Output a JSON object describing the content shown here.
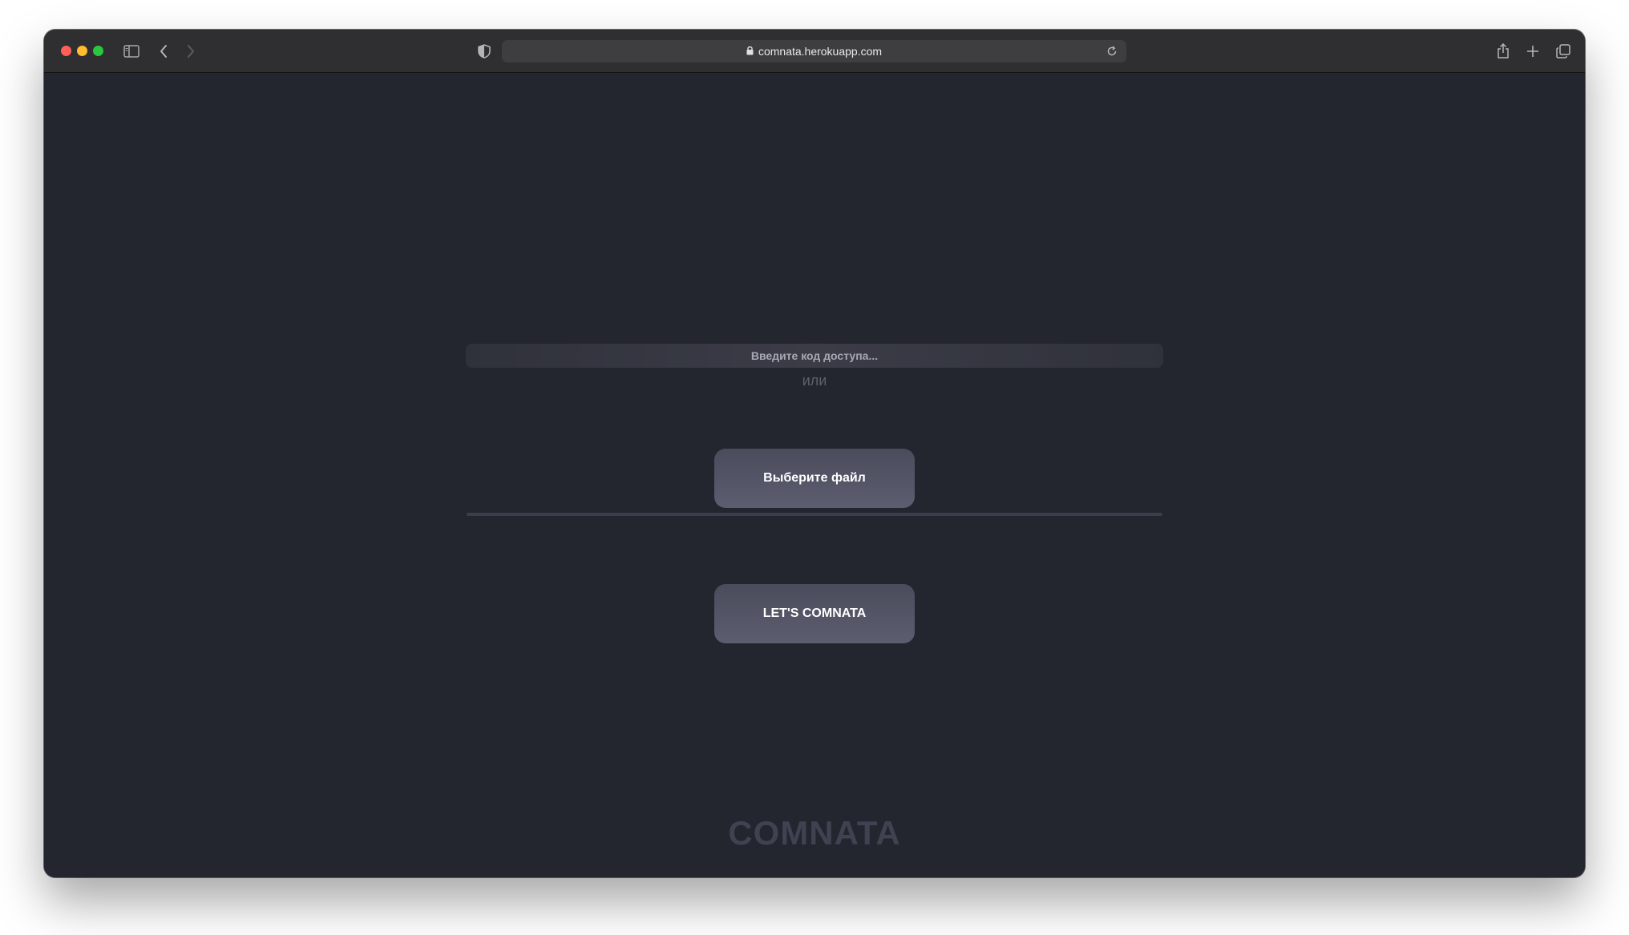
{
  "browser": {
    "url": "comnata.herokuapp.com",
    "icons": {
      "close": "close-dot",
      "minimize": "minimize-dot",
      "maximize": "maximize-dot",
      "sidebar": "sidebar-icon",
      "back": "chevron-left-icon",
      "forward": "chevron-right-icon",
      "privacy": "shield-icon",
      "lock": "lock-icon",
      "reload": "reload-icon",
      "share": "share-icon",
      "new_tab": "plus-icon",
      "tabs": "tabs-overview-icon"
    },
    "colors": {
      "close": "#fe5f57",
      "minimize": "#febc2e",
      "maximize": "#28c840"
    }
  },
  "page": {
    "code_input": {
      "placeholder": "Введите код доступа...",
      "value": ""
    },
    "or_label": "или",
    "choose_file_label": "Выберите файл",
    "submit_label": "LET'S COMNATA",
    "brand": "COMNATA",
    "colors": {
      "background": "#23262f",
      "button": "#555769",
      "brand_text": "#3f4250"
    }
  }
}
